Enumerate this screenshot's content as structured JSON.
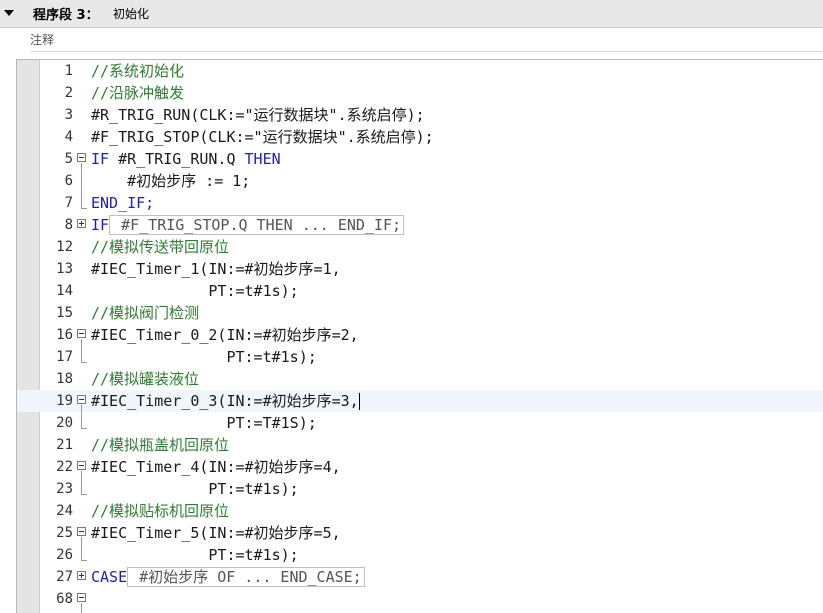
{
  "network": {
    "title": "程序段 3：",
    "subtitle": "初始化",
    "comment_label": "注释"
  },
  "lines": [
    {
      "num": "1",
      "text": "//系统初始化"
    },
    {
      "num": "2",
      "text": "//沿脉冲触发"
    },
    {
      "num": "3",
      "text": "#R_TRIG_RUN(CLK:=\"运行数据块\".系统启停);"
    },
    {
      "num": "4",
      "text": "#F_TRIG_STOP(CLK:=\"运行数据块\".系统启停);"
    },
    {
      "num": "5",
      "kw": "IF",
      "text": " #R_TRIG_RUN.Q ",
      "kw2": "THEN"
    },
    {
      "num": "6",
      "text": "    #初始步序 := 1;"
    },
    {
      "num": "7",
      "text": "END_IF;"
    },
    {
      "num": "8",
      "kw": "IF",
      "collapsed": " #F_TRIG_STOP.Q THEN ... END_IF;"
    },
    {
      "num": "12",
      "text": "//模拟传送带回原位"
    },
    {
      "num": "13",
      "text": "#IEC_Timer_1(IN:=#初始步序=1,"
    },
    {
      "num": "14",
      "text": "             PT:=t#1s);"
    },
    {
      "num": "15",
      "text": "//模拟阀门检测"
    },
    {
      "num": "16",
      "text": "#IEC_Timer_0_2(IN:=#初始步序=2,"
    },
    {
      "num": "17",
      "text": "               PT:=t#1s);"
    },
    {
      "num": "18",
      "text": "//模拟罐装液位"
    },
    {
      "num": "19",
      "text": "#IEC_Timer_0_3(IN:=#初始步序=3,"
    },
    {
      "num": "20",
      "text": "               PT:=T#1S);"
    },
    {
      "num": "21",
      "text": "//模拟瓶盖机回原位"
    },
    {
      "num": "22",
      "text": "#IEC_Timer_4(IN:=#初始步序=4,"
    },
    {
      "num": "23",
      "text": "             PT:=t#1s);"
    },
    {
      "num": "24",
      "text": "//模拟贴标机回原位"
    },
    {
      "num": "25",
      "text": "#IEC_Timer_5(IN:=#初始步序=5,"
    },
    {
      "num": "26",
      "text": "             PT:=t#1s);"
    },
    {
      "num": "27",
      "kw": "CASE",
      "collapsed": " #初始步序 OF ... END_CASE;"
    },
    {
      "num": "68",
      "text": ""
    }
  ]
}
